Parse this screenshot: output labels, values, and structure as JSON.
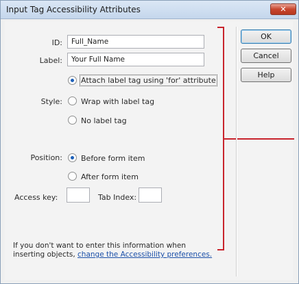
{
  "window": {
    "title": "Input Tag Accessibility Attributes",
    "close_label": "✕"
  },
  "form": {
    "id_label": "ID:",
    "id_value": "Full_Name",
    "label_label": "Label:",
    "label_value": "Your Full Name",
    "style_label": "Style:",
    "style_options": [
      {
        "label": "Attach label tag using 'for' attribute",
        "checked": true
      },
      {
        "label": "Wrap with label tag",
        "checked": false
      },
      {
        "label": "No label tag",
        "checked": false
      }
    ],
    "position_label": "Position:",
    "position_options": [
      {
        "label": "Before form item",
        "checked": true
      },
      {
        "label": "After form item",
        "checked": false
      }
    ],
    "access_key_label": "Access key:",
    "access_key_value": "",
    "tab_index_label": "Tab Index:",
    "tab_index_value": ""
  },
  "buttons": {
    "ok": "OK",
    "cancel": "Cancel",
    "help": "Help"
  },
  "note": {
    "line1": "If you don't want to enter this information when",
    "line2_prefix": "inserting objects, ",
    "link": "change the Accessibility preferences."
  },
  "colors": {
    "annotation": "#c8232c",
    "link": "#1a4fa8"
  }
}
